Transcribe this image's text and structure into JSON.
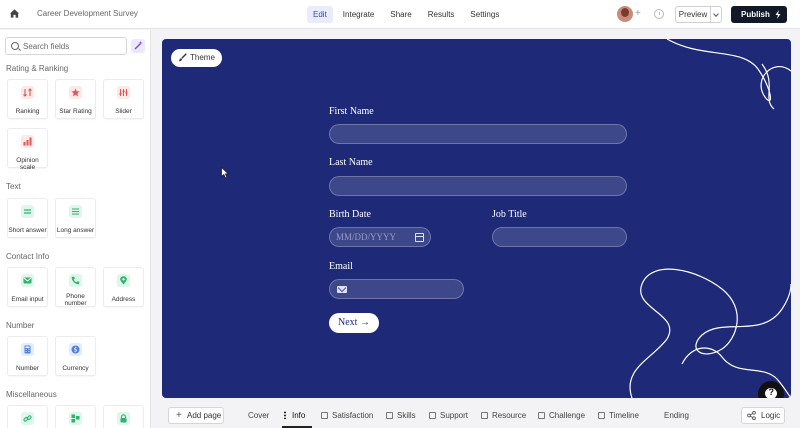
{
  "header": {
    "survey_title": "Career Development Survey",
    "tabs": [
      {
        "label": "Edit",
        "active": true
      },
      {
        "label": "Integrate"
      },
      {
        "label": "Share"
      },
      {
        "label": "Results"
      },
      {
        "label": "Settings"
      }
    ],
    "preview_label": "Preview",
    "publish_label": "Publish"
  },
  "sidebar": {
    "search_placeholder": "Search fields",
    "sections": [
      {
        "title": "Rating & Ranking",
        "items": [
          "Ranking",
          "Star Rating",
          "Slider",
          "Opinion scale"
        ]
      },
      {
        "title": "Text",
        "items": [
          "Short answer",
          "Long answer"
        ]
      },
      {
        "title": "Contact Info",
        "items": [
          "Email input",
          "Phone number",
          "Address"
        ]
      },
      {
        "title": "Number",
        "items": [
          "Number",
          "Currency"
        ]
      },
      {
        "title": "Miscellaneous",
        "items": []
      }
    ]
  },
  "form": {
    "theme_label": "Theme",
    "fields": {
      "first_name": "First Name",
      "last_name": "Last Name",
      "birth_date": "Birth Date",
      "birth_date_placeholder": "MM/DD/YYYY",
      "job_title": "Job Title",
      "email": "Email"
    },
    "next_label": "Next →"
  },
  "footer": {
    "add_page_label": "Add page",
    "pages": [
      "Cover",
      "Info",
      "Satisfaction",
      "Skills",
      "Support",
      "Resource",
      "Challenge",
      "Timeline",
      "Ending"
    ],
    "active_page": "Info",
    "logic_label": "Logic"
  },
  "colors": {
    "canvas_bg": "#1e2a78",
    "accent": "#3a4ab0",
    "publish_bg": "#111827"
  }
}
